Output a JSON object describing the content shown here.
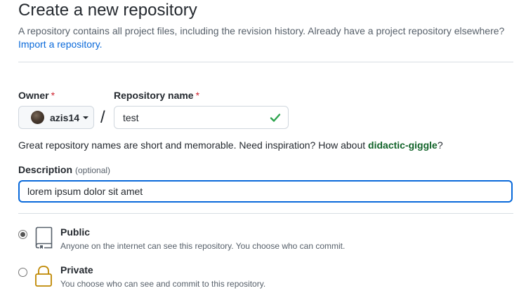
{
  "header": {
    "title": "Create a new repository",
    "subtitle": "A repository contains all project files, including the revision history. Already have a project repository elsewhere?",
    "import_link": "Import a repository."
  },
  "owner": {
    "label": "Owner",
    "required_mark": "*",
    "value": "azis14"
  },
  "separator": "/",
  "repository": {
    "label": "Repository name",
    "required_mark": "*",
    "value": "test",
    "valid": true
  },
  "name_hint": {
    "text": "Great repository names are short and memorable. Need inspiration? How about ",
    "suggestion": "didactic-giggle",
    "suffix": "?"
  },
  "description": {
    "label": "Description",
    "optional": "(optional)",
    "value": "lorem ipsum dolor sit amet"
  },
  "visibility": {
    "options": [
      {
        "title": "Public",
        "description": "Anyone on the internet can see this repository. You choose who can commit.",
        "icon": "repo-icon",
        "selected": true
      },
      {
        "title": "Private",
        "description": "You choose who can see and commit to this repository.",
        "icon": "lock-icon",
        "selected": false
      }
    ]
  },
  "colors": {
    "link": "#0969da",
    "required": "#cf222e",
    "success": "#2da44e",
    "focus_border": "#0969da"
  }
}
